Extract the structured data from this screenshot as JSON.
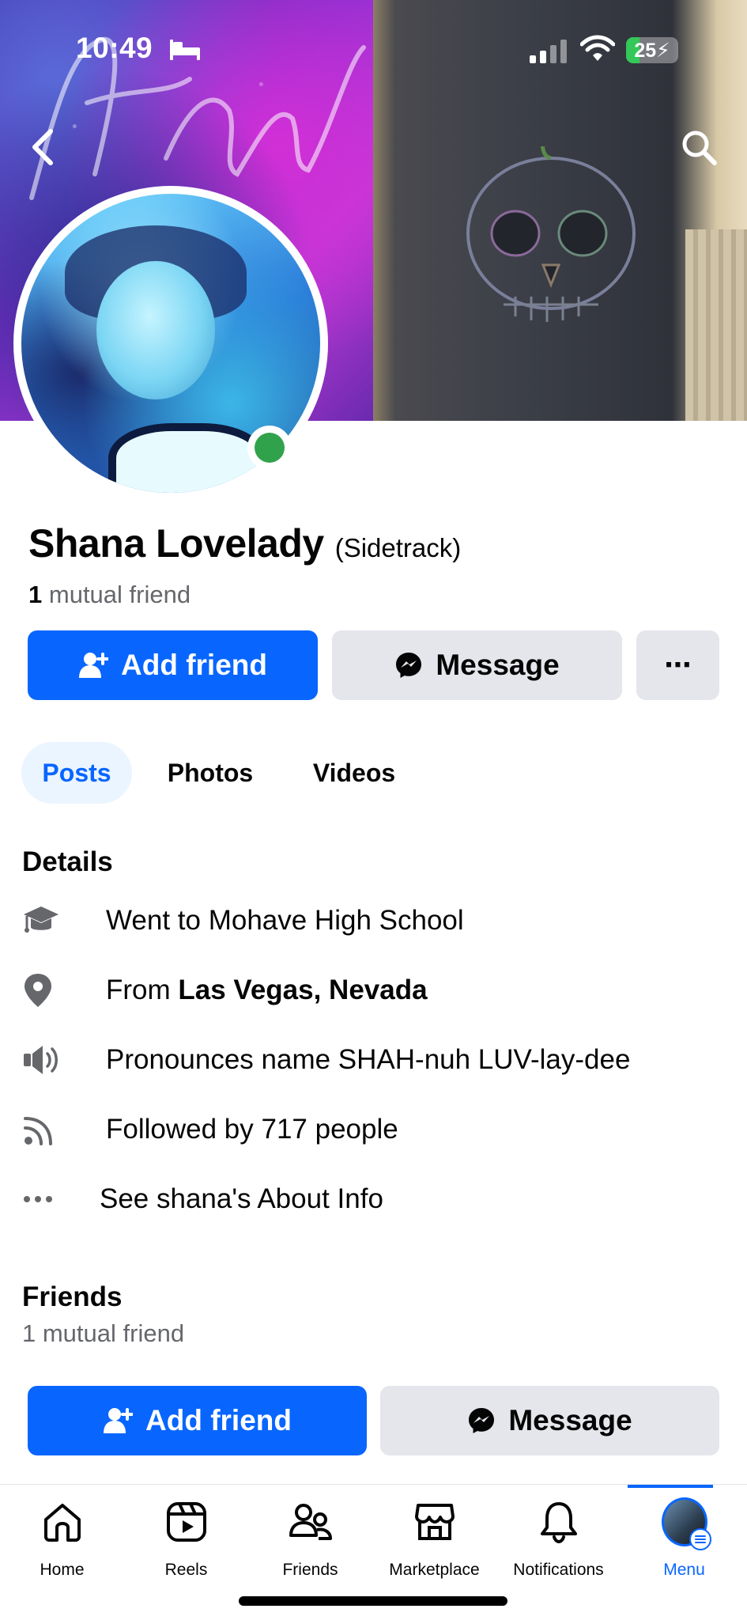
{
  "status_bar": {
    "time": "10:49",
    "battery": "25",
    "battery_level": 0.25
  },
  "profile": {
    "name": "Shana Lovelady",
    "alt_name": "(Sidetrack)",
    "mutual_count": "1",
    "mutual_text": "mutual friend",
    "online": true
  },
  "actions": {
    "add_friend": "Add friend",
    "message": "Message",
    "more": "⋯"
  },
  "tabs": [
    {
      "label": "Posts",
      "active": true
    },
    {
      "label": "Photos",
      "active": false
    },
    {
      "label": "Videos",
      "active": false
    }
  ],
  "details": {
    "title": "Details",
    "school": "Went to Mohave High School",
    "from_prefix": "From ",
    "from_place": "Las Vegas, Nevada",
    "pronounce": "Pronounces name SHAH-nuh LUV-lay-dee",
    "followed": "Followed by 717 people",
    "about": "See shana's About Info"
  },
  "friends": {
    "title": "Friends",
    "subtitle": "1 mutual friend"
  },
  "nav": [
    {
      "label": "Home",
      "icon": "home-icon"
    },
    {
      "label": "Reels",
      "icon": "reels-icon"
    },
    {
      "label": "Friends",
      "icon": "friends-icon"
    },
    {
      "label": "Marketplace",
      "icon": "marketplace-icon"
    },
    {
      "label": "Notifications",
      "icon": "bell-icon"
    },
    {
      "label": "Menu",
      "icon": "menu-avatar",
      "active": true
    }
  ],
  "colors": {
    "accent": "#0866ff",
    "online": "#31a24c",
    "secondary_button": "#e4e6eb",
    "muted_text": "#65676b"
  }
}
